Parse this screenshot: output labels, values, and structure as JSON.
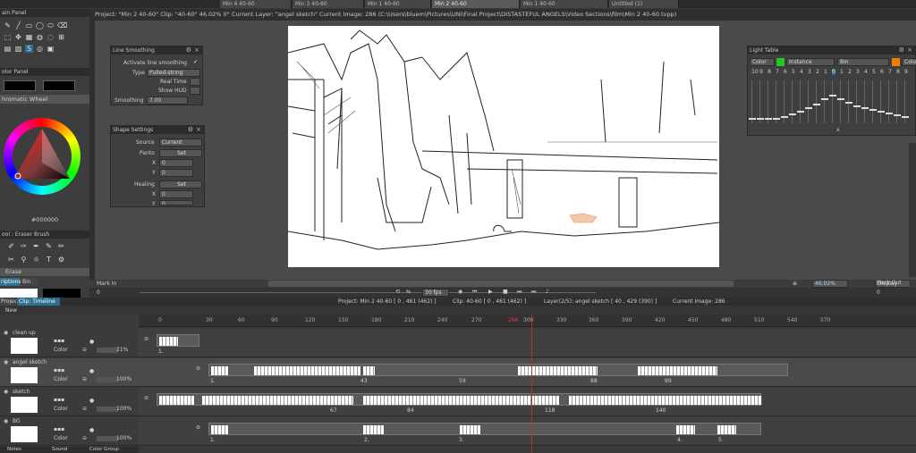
{
  "tabs": [
    "Min 4 40-60",
    "Min 3 40-60",
    "Min 1 40-60",
    "Min 2 40-60",
    "Min 1 40-60",
    "Untitled (1)"
  ],
  "path_text": "Project: \"Min 2 40-60\"  Clip: \"40-60\"  46.02%  0°  Current Layer: \"angel sketch\"  Current Image: 286 (C:\\Users\\bluem\\Pictures\\UNI\\Final Project\\DISTASTEFUL ANGELS\\Video Sections\\film\\Min 2 40-60.tvpp)",
  "left_panels": {
    "main_panel": "ain Panel",
    "color_panel": "olor Panel",
    "chromatic": "hromatic Wheel",
    "hex": "#000000",
    "tool_panel": "ool : Eraser Brush",
    "erase_label": "Erase",
    "tabs": [
      "riptions",
      "Bin"
    ]
  },
  "line_smoothing": {
    "title": "Line Smoothing",
    "activate": "Activate line smoothing",
    "type_label": "Type",
    "type_value": "Pulled-string",
    "realtime": "Real Time",
    "showhud": "Show HUD",
    "smoothing_label": "Smoothing",
    "smoothing_value": "7.00"
  },
  "shape_settings": {
    "title": "Shape Settings",
    "source_label": "Source",
    "source_value": "Current",
    "panto_label": "Panto",
    "panto_btn": "Set",
    "x": "X",
    "y": "Y",
    "zero": "0",
    "healing_label": "Healing",
    "healing_btn": "Set"
  },
  "light_table": {
    "title": "Light Table",
    "color": "Color",
    "instance": "Instance",
    "bin": "Bin",
    "color2": "Colo",
    "numbers_left": [
      "10",
      "9",
      "8",
      "7",
      "6",
      "5",
      "4",
      "3",
      "2",
      "1",
      "0"
    ],
    "numbers_right": [
      "1",
      "2",
      "3",
      "4",
      "5",
      "6",
      "7",
      "8",
      "9"
    ],
    "x_label": "x"
  },
  "bottombar": {
    "zoom": "46.02%",
    "display": "Display",
    "mark_in": "Mark In",
    "mark_out": "Mark Out",
    "mark_in_val": "0",
    "mark_out_val": "0"
  },
  "transport": {
    "fps": "30 fps"
  },
  "timeline_header": {
    "tab1": "Project",
    "tab2": "Clip: Timeline",
    "info_project": "Project: Min 2 40-60 [ 0 , 461  (462) ]",
    "info_clip": "Clip: 40-60 [ 0 , 461  (462) ]",
    "info_layer": "Layer(2/5): angel sketch [ 40 , 429  (390) ]",
    "info_image": "Current Image: 286",
    "new": "New"
  },
  "ruler_ticks": [
    "0",
    "30",
    "60",
    "90",
    "120",
    "150",
    "180",
    "210",
    "240",
    "270",
    "286",
    "300",
    "330",
    "360",
    "390",
    "420",
    "450",
    "480",
    "510",
    "540",
    "570"
  ],
  "layers": [
    {
      "name": "clean up",
      "mode": "Color",
      "opacity": "21%"
    },
    {
      "name": "angel sketch",
      "mode": "Color",
      "opacity": "100%"
    },
    {
      "name": "sketch",
      "mode": "Color",
      "opacity": "100%"
    },
    {
      "name": "BG",
      "mode": "Color",
      "opacity": "100%"
    }
  ],
  "track_markers": {
    "t0": [
      "1."
    ],
    "t1": [
      "1.",
      "43",
      "59",
      "88",
      "99"
    ],
    "t2": [
      "67",
      "84",
      "118",
      "140"
    ],
    "t3": [
      "1.",
      "2.",
      "3.",
      "4.",
      "5."
    ]
  },
  "footer": [
    "Notes",
    "Sound",
    "Color Group"
  ]
}
